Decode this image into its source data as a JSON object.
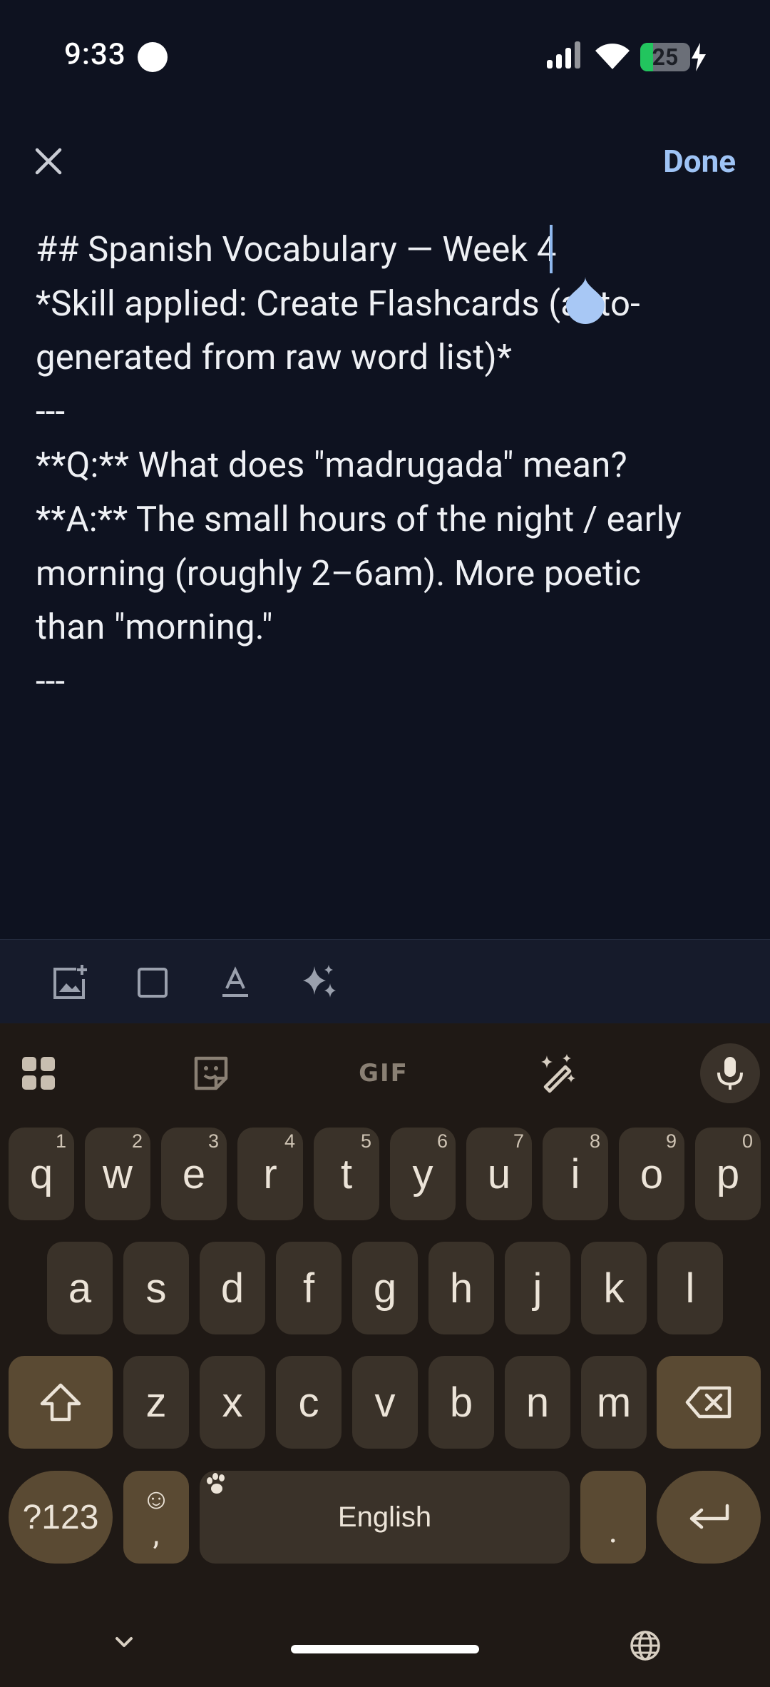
{
  "status_bar": {
    "time": "9:33",
    "battery_level": "25",
    "battery_fraction": 0.25,
    "icons": [
      "recording-dot-icon",
      "signal-icon",
      "wifi-icon",
      "battery-icon",
      "charging-bolt-icon"
    ]
  },
  "header": {
    "close_icon": "close-icon",
    "done_label": "Done"
  },
  "editor": {
    "lines": [
      "## Spanish Vocabulary — Week 4",
      "",
      "*Skill applied: Create Flashcards (auto-",
      "generated from raw word list)*",
      "",
      "---",
      "",
      "**Q:** What does \"madrugada\" mean?",
      "**A:** The small hours of the night / early",
      "morning (roughly 2–6am). More poetic",
      "than \"morning.\"",
      "",
      "---"
    ]
  },
  "format_toolbar": {
    "buttons": [
      "add-image-icon",
      "checkbox-icon",
      "text-format-icon",
      "ai-sparkle-icon"
    ]
  },
  "keyboard": {
    "toolbar": {
      "apps_icon": "apps-grid-icon",
      "sticker_icon": "sticker-icon",
      "gif_label": "GIF",
      "magic_icon": "magic-wand-icon",
      "mic_icon": "microphone-icon"
    },
    "row1": [
      {
        "key": "q",
        "num": "1"
      },
      {
        "key": "w",
        "num": "2"
      },
      {
        "key": "e",
        "num": "3"
      },
      {
        "key": "r",
        "num": "4"
      },
      {
        "key": "t",
        "num": "5"
      },
      {
        "key": "y",
        "num": "6"
      },
      {
        "key": "u",
        "num": "7"
      },
      {
        "key": "i",
        "num": "8"
      },
      {
        "key": "o",
        "num": "9"
      },
      {
        "key": "p",
        "num": "0"
      }
    ],
    "row2": [
      "a",
      "s",
      "d",
      "f",
      "g",
      "h",
      "j",
      "k",
      "l"
    ],
    "row3": [
      "z",
      "x",
      "c",
      "v",
      "b",
      "n",
      "m"
    ],
    "symbols_label": "?123",
    "emoji_top": "☺",
    "comma": ",",
    "space_label": "English",
    "period": "."
  },
  "nav_bar": {
    "hide_keyboard_icon": "chevron-down-icon",
    "language_icon": "globe-icon"
  },
  "colors": {
    "background": "#0e1220",
    "accent": "#9ec3f5",
    "keyboard_bg": "#1f1915",
    "key_bg": "#3a3229",
    "special_key_bg": "#5a4a33"
  }
}
